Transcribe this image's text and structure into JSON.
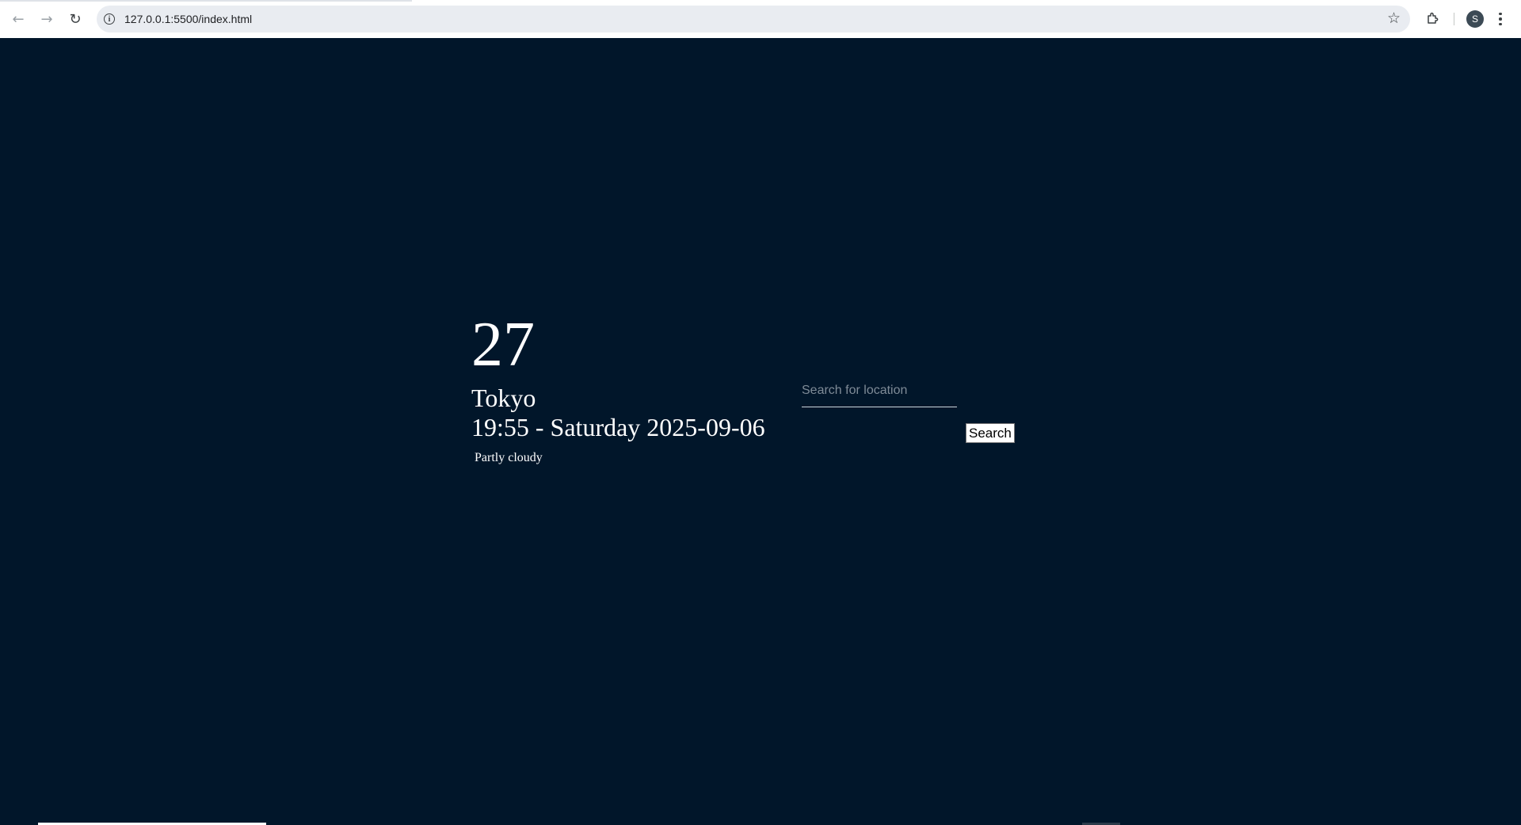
{
  "browser": {
    "url": "127.0.0.1:5500/index.html",
    "profile_initial": "S",
    "icons": {
      "back": "arrow-left",
      "forward": "arrow-right",
      "reload": "reload",
      "site_info": "info",
      "bookmark": "star",
      "extensions": "puzzle-piece",
      "menu": "vertical-dots"
    }
  },
  "weather": {
    "temperature": "27",
    "city": "Tokyo",
    "datetime": "19:55 - Saturday 2025-09-06",
    "condition": "Partly cloudy"
  },
  "search": {
    "placeholder": "Search for location",
    "value": "",
    "button_label": "Search"
  },
  "colors": {
    "page_background": "#01162a",
    "text": "#ffffff"
  }
}
